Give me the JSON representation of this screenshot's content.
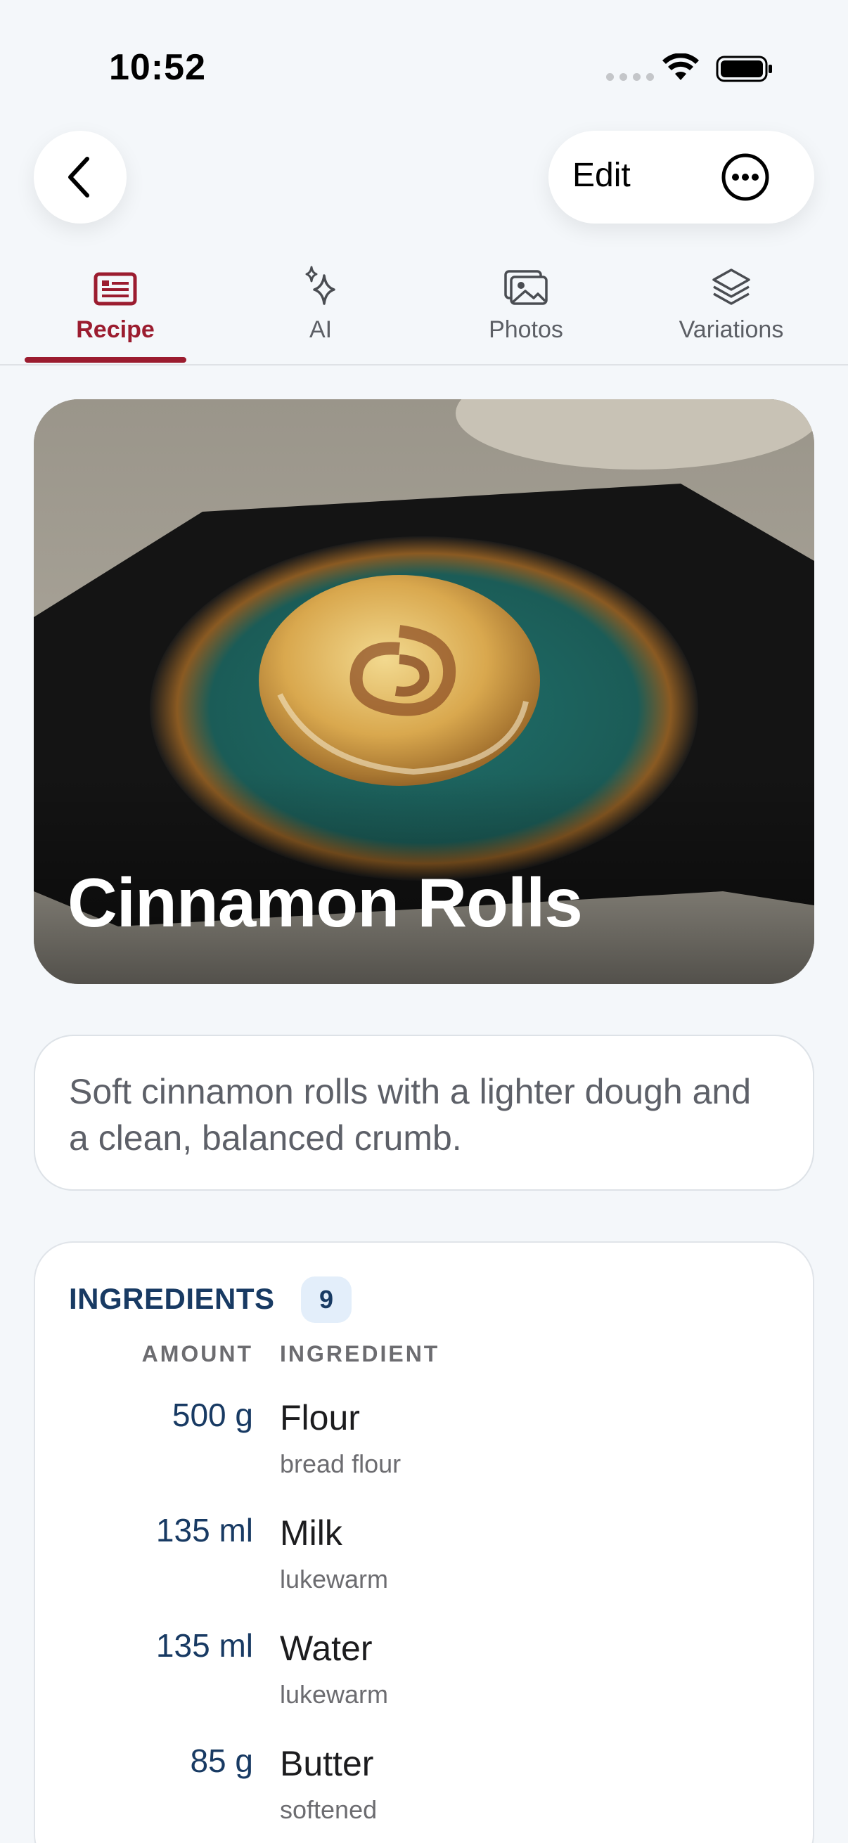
{
  "status_bar": {
    "time": "10:52"
  },
  "nav": {
    "edit_label": "Edit"
  },
  "tabs": [
    {
      "label": "Recipe",
      "icon": "recipe-icon",
      "active": true
    },
    {
      "label": "AI",
      "icon": "sparkles-icon",
      "active": false
    },
    {
      "label": "Photos",
      "icon": "photos-icon",
      "active": false
    },
    {
      "label": "Variations",
      "icon": "layers-icon",
      "active": false
    }
  ],
  "recipe": {
    "title": "Cinnamon Rolls",
    "description": "Soft cinnamon rolls with a lighter dough and a clean, balanced crumb."
  },
  "ingredients": {
    "header": "INGREDIENTS",
    "count": "9",
    "column_amount": "AMOUNT",
    "column_ingredient": "INGREDIENT",
    "items": [
      {
        "amount": "500 g",
        "name": "Flour",
        "note": "bread flour"
      },
      {
        "amount": "135 ml",
        "name": "Milk",
        "note": "lukewarm"
      },
      {
        "amount": "135 ml",
        "name": "Water",
        "note": "lukewarm"
      },
      {
        "amount": "85 g",
        "name": "Butter",
        "note": "softened"
      }
    ]
  },
  "colors": {
    "accent": "#9b1c2f",
    "navy": "#183a63",
    "background": "#f4f7fa"
  }
}
